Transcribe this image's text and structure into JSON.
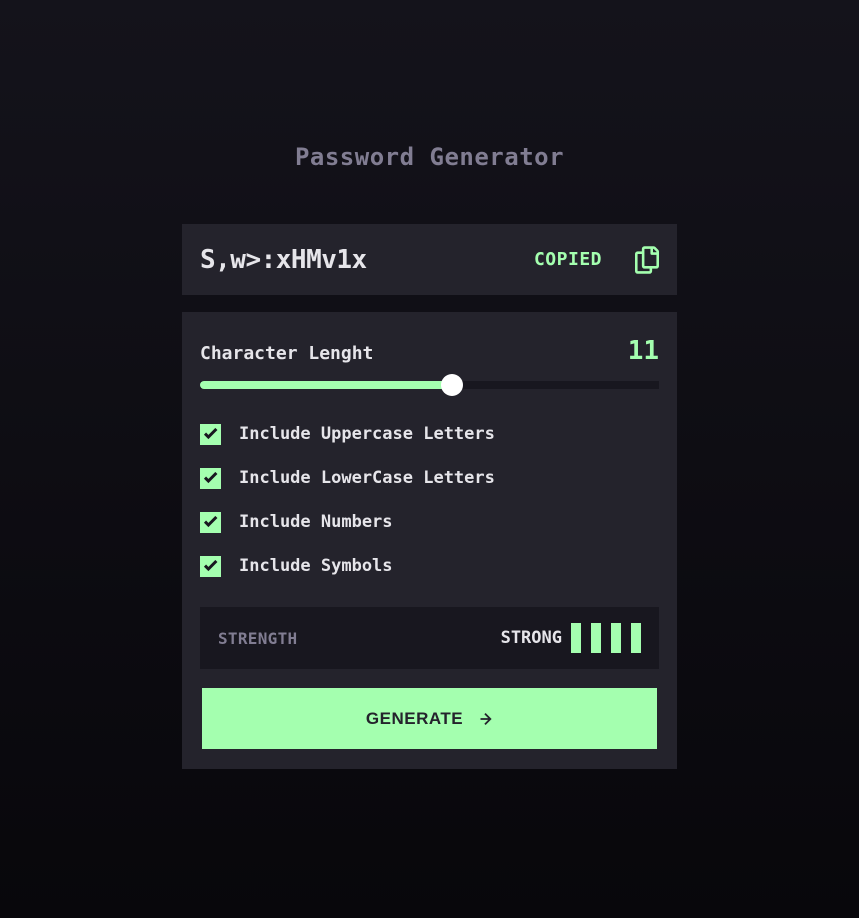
{
  "app": {
    "title": "Password Generator"
  },
  "password": {
    "value": "S,w>:xHMv1x",
    "copied_label": "COPIED",
    "copy_icon": "copy-icon"
  },
  "length": {
    "label": "Character Lenght",
    "value": "11",
    "slider_fraction": 0.548
  },
  "options": [
    {
      "label": "Include Uppercase Letters",
      "checked": true
    },
    {
      "label": "Include LowerCase Letters",
      "checked": true
    },
    {
      "label": "Include Numbers",
      "checked": true
    },
    {
      "label": "Include Symbols",
      "checked": true
    }
  ],
  "strength": {
    "label": "STRENGTH",
    "value": "STRONG",
    "level": 4,
    "max_level": 4
  },
  "generate": {
    "label": "GENERATE",
    "icon": "arrow-right-icon"
  },
  "colors": {
    "accent": "#a4ffaf",
    "panel": "#24232c",
    "dark": "#18171f",
    "muted": "#817d92",
    "text": "#e6e5ea"
  }
}
